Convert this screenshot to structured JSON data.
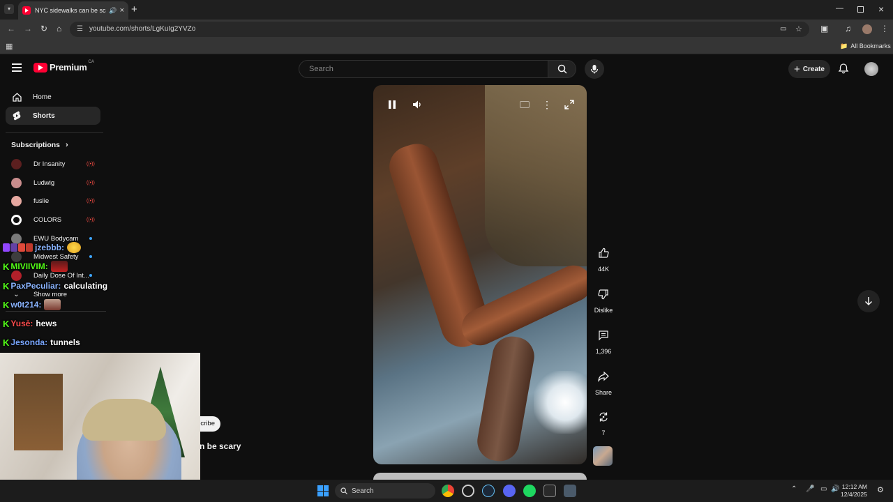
{
  "browser": {
    "tab_title": "NYC sidewalks can be scary",
    "url": "youtube.com/shorts/LgKuIg2YVZo",
    "all_bookmarks": "All Bookmarks"
  },
  "header": {
    "brand": "Premium",
    "region": "CA",
    "search_placeholder": "Search",
    "create_label": "Create"
  },
  "sidebar": {
    "items": [
      {
        "label": "Home"
      },
      {
        "label": "Shorts"
      }
    ],
    "subscriptions_title": "Subscriptions",
    "subscriptions": [
      {
        "name": "Dr Insanity",
        "color": "#5b1f1f"
      },
      {
        "name": "Ludwig",
        "color": "#c98d8d"
      },
      {
        "name": "fuslie",
        "color": "#e6a8a0"
      },
      {
        "name": "COLORS",
        "color": "#ffffff"
      },
      {
        "name": "EWU Bodycam",
        "color": "#7a7a7a"
      },
      {
        "name": "Midwest Safety",
        "color": "#3d3d3d"
      },
      {
        "name": "Daily Dose Of Int...",
        "color": "#b2202a"
      }
    ],
    "show_more": "Show more"
  },
  "video": {
    "title_partial": "n be scary",
    "subscribe_partial": "cribe"
  },
  "actions": {
    "likes": "44K",
    "dislike_label": "Dislike",
    "comments": "1,396",
    "share_label": "Share",
    "remix_count": "7"
  },
  "chat": [
    {
      "user": "jzebbb:",
      "message": "",
      "user_color": "#8ab4ff"
    },
    {
      "user": "MIVIIVIM:",
      "message": "",
      "user_color": "#53fc18"
    },
    {
      "user": "PaxPeculiar:",
      "message": "calculating",
      "user_color": "#8ab4ff"
    },
    {
      "user": "w0t214:",
      "message": "",
      "user_color": "#8ab4ff"
    },
    {
      "user": "Yusē:",
      "message": "hews",
      "user_color": "#ff4d4d"
    },
    {
      "user": "Jesonda:",
      "message": "tunnels",
      "user_color": "#7aa7ff"
    }
  ],
  "taskbar": {
    "search_label": "Search",
    "time": "12:12 AM",
    "date": "12/4/2025"
  },
  "colors": {
    "youtube_red": "#ff0033",
    "kick_green": "#53fc18"
  }
}
